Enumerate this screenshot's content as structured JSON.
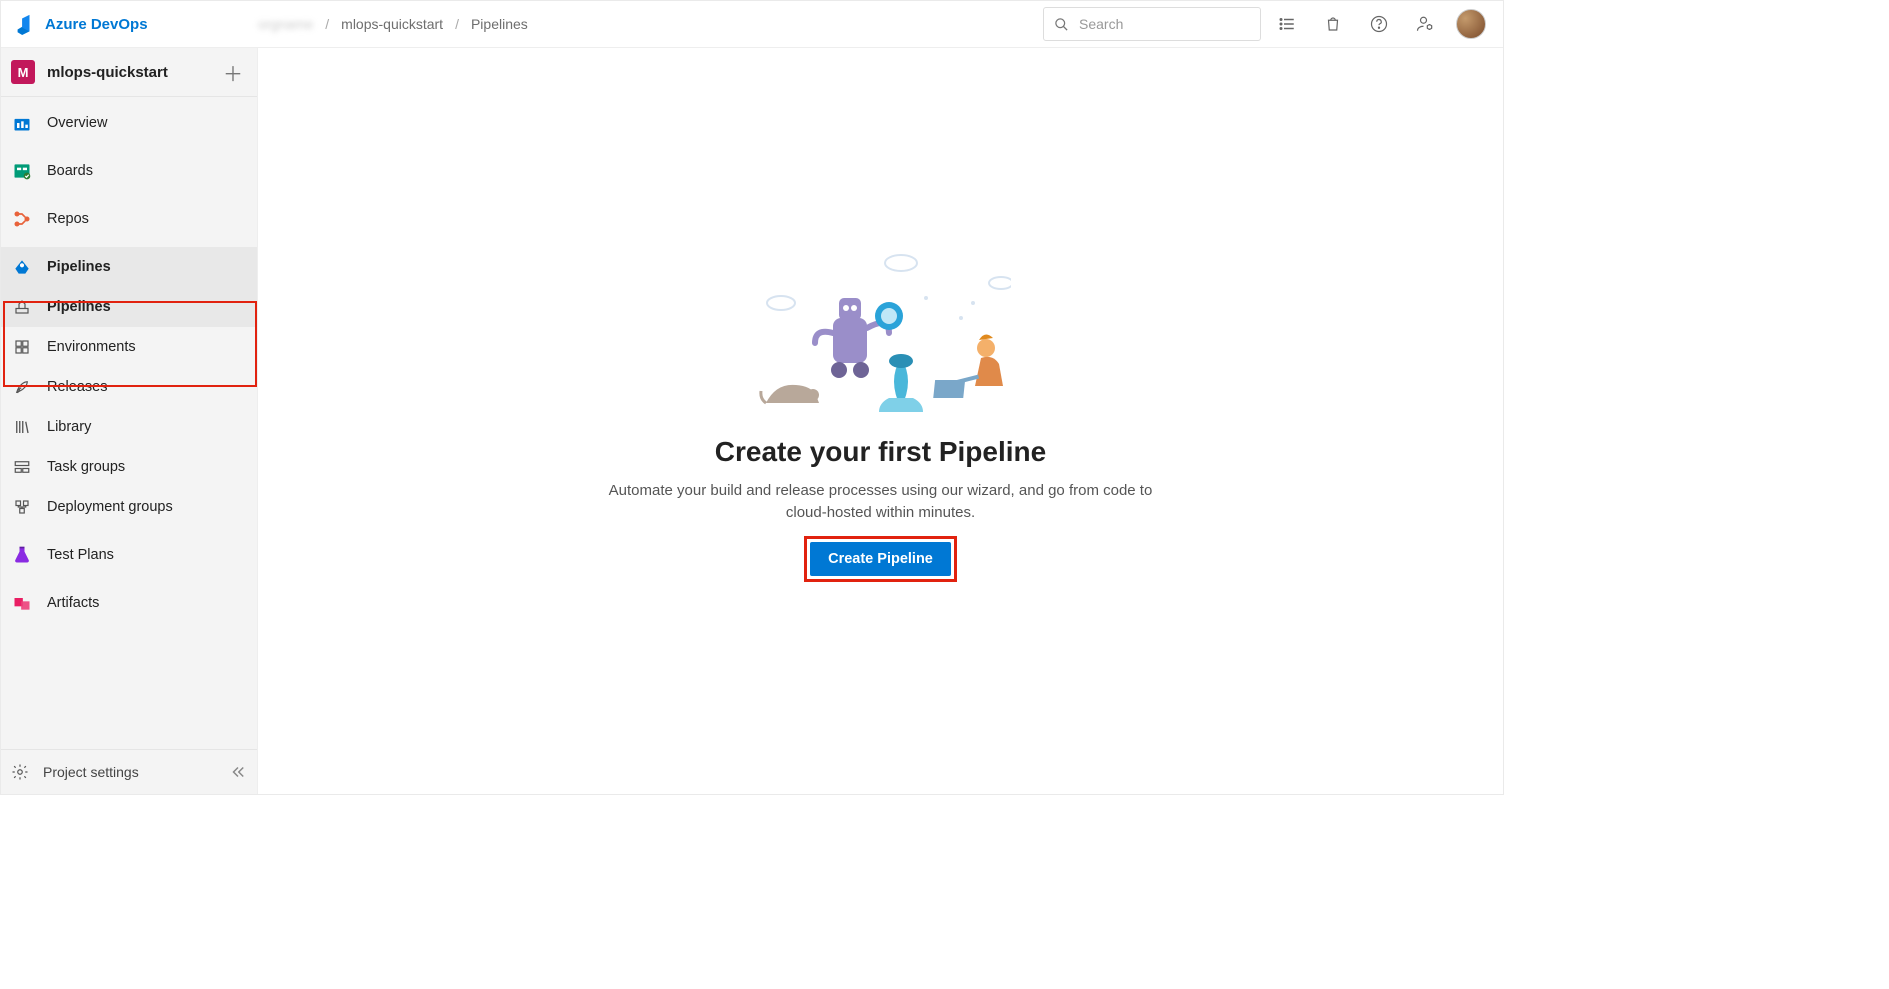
{
  "brand": "Azure DevOps",
  "breadcrumbs": {
    "org": "orgname",
    "project": "mlops-quickstart",
    "page": "Pipelines"
  },
  "search": {
    "placeholder": "Search"
  },
  "project": {
    "initial": "M",
    "name": "mlops-quickstart"
  },
  "sidebar": {
    "overview": "Overview",
    "boards": "Boards",
    "repos": "Repos",
    "pipelines": "Pipelines",
    "pipelines_sub": "Pipelines",
    "environments": "Environments",
    "releases": "Releases",
    "library": "Library",
    "taskgroups": "Task groups",
    "deploygroups": "Deployment groups",
    "testplans": "Test Plans",
    "artifacts": "Artifacts",
    "settings": "Project settings"
  },
  "hero": {
    "title": "Create your first Pipeline",
    "desc": "Automate your build and release processes using our wizard, and go from code to cloud-hosted within minutes.",
    "cta": "Create Pipeline"
  }
}
